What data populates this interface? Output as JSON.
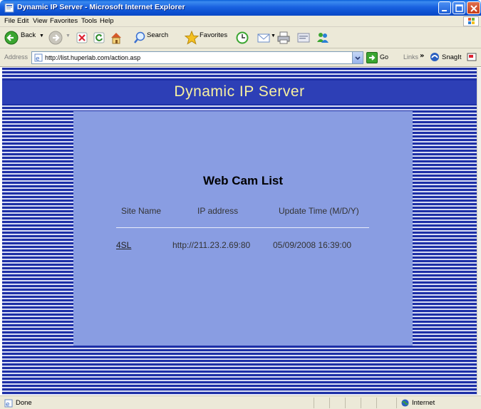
{
  "window": {
    "title": "Dynamic IP Server - Microsoft Internet Explorer"
  },
  "menu": [
    "File",
    "Edit",
    "View",
    "Favorites",
    "Tools",
    "Help"
  ],
  "toolbar": {
    "back_label": "Back",
    "search_label": "Search",
    "favorites_label": "Favorites"
  },
  "address": {
    "label": "Address",
    "url": "http://list.huperlab.com/action.asp",
    "go_label": "Go",
    "links_label": "Links",
    "chevron": "»",
    "snagit_label": "SnagIt"
  },
  "page": {
    "title": "Dynamic IP Server",
    "list_title": "Web Cam List",
    "columns": [
      "Site Name",
      "IP address",
      "Update Time (M/D/Y)"
    ],
    "rows": [
      {
        "site": "4SL",
        "ip": "http://211.23.2.69:80",
        "updated": "05/09/2008 16:39:00"
      }
    ]
  },
  "status": {
    "text": "Done",
    "zone": "Internet"
  },
  "colors": {
    "stripe_dark": "#1d2fa6",
    "stripe_light": "#d7dcf4",
    "panel": "#899de2",
    "title_text": "#f8f1a0"
  }
}
